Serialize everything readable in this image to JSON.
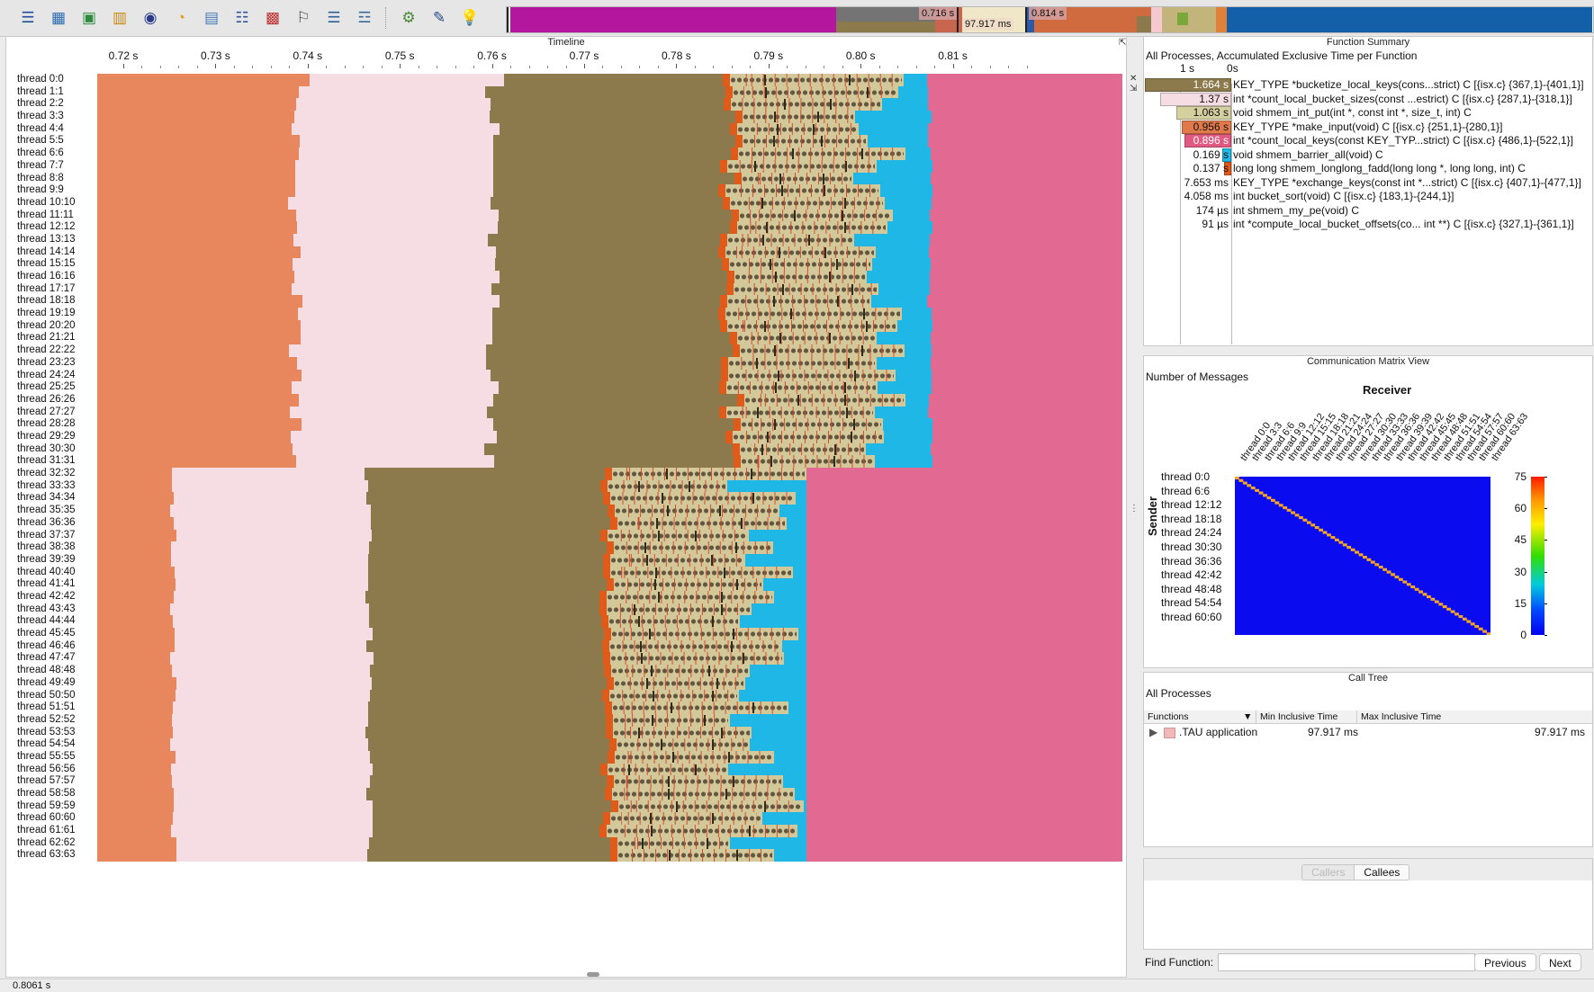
{
  "toolbar": {
    "icons": [
      {
        "name": "table-icon",
        "glyph": "☰"
      },
      {
        "name": "scatter-plot-icon",
        "glyph": "▦"
      },
      {
        "name": "image-icon",
        "glyph": "▣"
      },
      {
        "name": "bar-chart-icon",
        "glyph": "▥"
      },
      {
        "name": "globe-3d-icon",
        "glyph": "◉"
      },
      {
        "name": "pie-chart-icon",
        "glyph": "◔"
      },
      {
        "name": "window-icon",
        "glyph": "▤"
      },
      {
        "name": "list-icon",
        "glyph": "☷"
      },
      {
        "name": "heatmap-icon",
        "glyph": "▩"
      },
      {
        "name": "histogram-icon",
        "glyph": "⚐"
      },
      {
        "name": "document-list-icon",
        "glyph": "☰"
      },
      {
        "name": "tree-icon",
        "glyph": "☲"
      },
      {
        "name": "network-icon",
        "glyph": "⚙"
      },
      {
        "name": "pin-icon",
        "glyph": "✎"
      },
      {
        "name": "lightbulb-icon",
        "glyph": "💡"
      }
    ],
    "overview_labels": {
      "a": "0.716 s",
      "b": "97.917 ms",
      "c": "0.814 s"
    }
  },
  "timeline": {
    "title": "Timeline",
    "ticks": [
      "0.72 s",
      "0.73 s",
      "0.74 s",
      "0.75 s",
      "0.76 s",
      "0.77 s",
      "0.78 s",
      "0.79 s",
      "0.80 s",
      "0.81 s"
    ],
    "threads": [
      "thread 0:0",
      "thread 1:1",
      "thread 2:2",
      "thread 3:3",
      "thread 4:4",
      "thread 5:5",
      "thread 6:6",
      "thread 7:7",
      "thread 8:8",
      "thread 9:9",
      "thread 10:10",
      "thread 11:11",
      "thread 12:12",
      "thread 13:13",
      "thread 14:14",
      "thread 15:15",
      "thread 16:16",
      "thread 17:17",
      "thread 18:18",
      "thread 19:19",
      "thread 20:20",
      "thread 21:21",
      "thread 22:22",
      "thread 23:23",
      "thread 24:24",
      "thread 25:25",
      "thread 26:26",
      "thread 27:27",
      "thread 28:28",
      "thread 29:29",
      "thread 30:30",
      "thread 31:31",
      "thread 32:32",
      "thread 33:33",
      "thread 34:34",
      "thread 35:35",
      "thread 36:36",
      "thread 37:37",
      "thread 38:38",
      "thread 39:39",
      "thread 40:40",
      "thread 41:41",
      "thread 42:42",
      "thread 43:43",
      "thread 44:44",
      "thread 45:45",
      "thread 46:46",
      "thread 47:47",
      "thread 48:48",
      "thread 49:49",
      "thread 50:50",
      "thread 51:51",
      "thread 52:52",
      "thread 53:53",
      "thread 54:54",
      "thread 55:55",
      "thread 56:56",
      "thread 57:57",
      "thread 58:58",
      "thread 59:59",
      "thread 60:60",
      "thread 61:61",
      "thread 62:62",
      "thread 63:63"
    ],
    "colors": {
      "make_input": "#e8875e",
      "count_local_keys": "#f6dde3",
      "bucketize": "#8c7a4c",
      "shmem_int_put": "#d2c89a",
      "barrier": "#1fb8e6",
      "count_local_bucket_sizes": "#e26a92",
      "fadd": "#e05a1a"
    }
  },
  "function_summary": {
    "title": "Function Summary",
    "subtitle": "All Processes, Accumulated Exclusive Time per Function",
    "scale_left": "1 s",
    "scale_right": "0s",
    "rows": [
      {
        "value": "1.664 s",
        "name": "KEY_TYPE *bucketize_local_keys(cons...strict) C [{isx.c} {367,1}-{401,1}]",
        "color": "#8c7a4c",
        "frac": 1.0,
        "light": true
      },
      {
        "value": "1.37 s",
        "name": "int *count_local_bucket_sizes(const ...estrict) C [{isx.c} {287,1}-{318,1}]",
        "color": "#f6dde3",
        "frac": 0.823,
        "light": false
      },
      {
        "value": "1.063 s",
        "name": "void shmem_int_put(int *, const int *, size_t, int) C",
        "color": "#d6d0a0",
        "frac": 0.639,
        "light": false
      },
      {
        "value": "0.956 s",
        "name": "KEY_TYPE *make_input(void) C [{isx.c} {251,1}-{280,1}]",
        "color": "#e07a4a",
        "frac": 0.575,
        "light": false
      },
      {
        "value": "0.896 s",
        "name": "int *count_local_keys(const KEY_TYP...strict) C [{isx.c} {486,1}-{522,1}]",
        "color": "#e05a82",
        "frac": 0.538,
        "light": true
      },
      {
        "value": "0.169 s",
        "name": "void shmem_barrier_all(void) C",
        "color": "#1fb8e6",
        "frac": 0.1,
        "light": false
      },
      {
        "value": "0.137 s",
        "name": "long long shmem_longlong_fadd(long long *, long long, int) C",
        "color": "#e05a1a",
        "frac": 0.082,
        "light": false
      },
      {
        "value": "7.653 ms",
        "name": "KEY_TYPE *exchange_keys(const int *...strict) C [{isx.c} {407,1}-{477,1}]",
        "color": "#cccccc",
        "frac": 0.0,
        "light": false
      },
      {
        "value": "4.058 ms",
        "name": "int bucket_sort(void) C [{isx.c} {183,1}-{244,1}]",
        "color": "#cccccc",
        "frac": 0.0,
        "light": false
      },
      {
        "value": "174 µs",
        "name": "int shmem_my_pe(void) C",
        "color": "#cccccc",
        "frac": 0.0,
        "light": false
      },
      {
        "value": "91 µs",
        "name": "int *compute_local_bucket_offsets(co... int **) C [{isx.c} {327,1}-{361,1}]",
        "color": "#cccccc",
        "frac": 0.0,
        "light": false
      }
    ]
  },
  "comm_matrix": {
    "title": "Communication Matrix View",
    "subtitle": "Number of Messages",
    "receiver_label": "Receiver",
    "sender_label": "Sender",
    "col_labels": [
      "thread 0:0",
      "thread 3:3",
      "thread 6:6",
      "thread 9:9",
      "thread 12:12",
      "thread 15:15",
      "thread 18:18",
      "thread 21:21",
      "thread 24:24",
      "thread 27:27",
      "thread 30:30",
      "thread 33:33",
      "thread 36:36",
      "thread 39:39",
      "thread 42:42",
      "thread 45:45",
      "thread 48:48",
      "thread 51:51",
      "thread 54:54",
      "thread 57:57",
      "thread 60:60",
      "thread 63:63"
    ],
    "row_labels": [
      "thread 0:0",
      "thread 6:6",
      "thread 12:12",
      "thread 18:18",
      "thread 24:24",
      "thread 30:30",
      "thread 36:36",
      "thread 42:42",
      "thread 48:48",
      "thread 54:54",
      "thread 60:60"
    ],
    "colorbar_labels": [
      "75",
      "60",
      "45",
      "30",
      "15",
      "0"
    ],
    "matrix_background": "#0b0bf0",
    "diagonal_color": "#f5a623",
    "diagonal_value": 75
  },
  "call_tree": {
    "title": "Call Tree",
    "subtitle": "All Processes",
    "columns": [
      "Functions",
      "Min Inclusive Time",
      "Max Inclusive Time"
    ],
    "rows": [
      {
        "name": ".TAU application",
        "min": "97.917 ms",
        "max": "97.917 ms"
      }
    ]
  },
  "callers_callees": {
    "tabs": [
      "Callers",
      "Callees"
    ]
  },
  "find": {
    "label": "Find Function:",
    "value": "",
    "previous": "Previous",
    "next": "Next"
  },
  "status": {
    "time": "0.8061 s"
  }
}
